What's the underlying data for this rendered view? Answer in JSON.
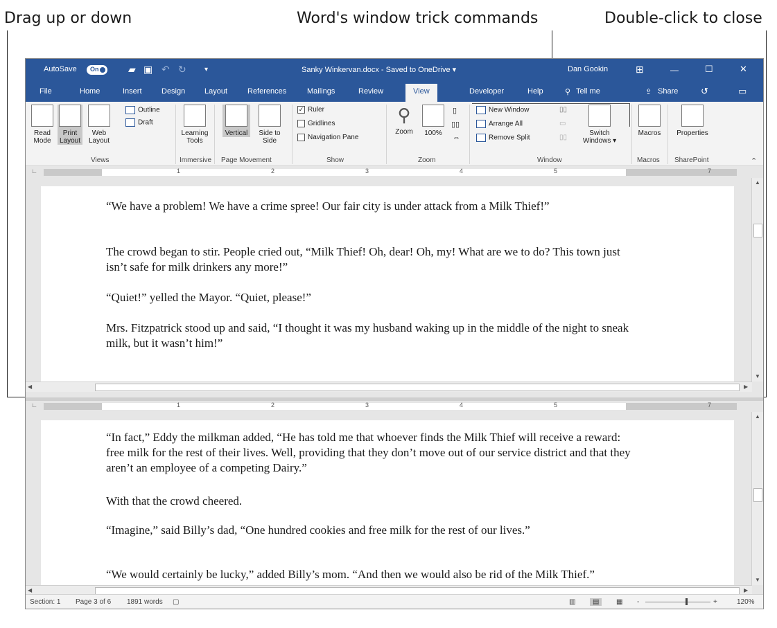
{
  "callouts": {
    "left": "Drag up or down",
    "middle": "Word's window trick commands",
    "right": "Double-click to close"
  },
  "titlebar": {
    "autosave": "AutoSave",
    "toggle": "On",
    "document_title": "Sanky Winkervan.docx - Saved to OneDrive ▾",
    "user": "Dan Gookin",
    "minimize": "—",
    "restore": "☐",
    "close": "✕"
  },
  "tabs": [
    "File",
    "Home",
    "Insert",
    "Design",
    "Layout",
    "References",
    "Mailings",
    "Review",
    "View",
    "Developer",
    "Help"
  ],
  "tell_me": "Tell me",
  "share": "Share",
  "ribbon": {
    "views": {
      "read_mode": "Read Mode",
      "print_layout": "Print Layout",
      "web_layout": "Web Layout",
      "outline": "Outline",
      "draft": "Draft",
      "label": "Views"
    },
    "immersive": {
      "learning_tools": "Learning Tools",
      "label": "Immersive"
    },
    "page_movement": {
      "vertical": "Vertical",
      "side_to_side": "Side to Side",
      "label": "Page Movement"
    },
    "show": {
      "ruler": "Ruler",
      "gridlines": "Gridlines",
      "navigation_pane": "Navigation Pane",
      "label": "Show"
    },
    "zoom": {
      "zoom": "Zoom",
      "percent": "100%",
      "label": "Zoom"
    },
    "window": {
      "new_window": "New Window",
      "arrange_all": "Arrange All",
      "remove_split": "Remove Split",
      "switch_windows": "Switch Windows ▾",
      "label": "Window"
    },
    "macros": {
      "macros": "Macros",
      "label": "Macros"
    },
    "sharepoint": {
      "properties": "Properties",
      "label": "SharePoint"
    }
  },
  "ruler_numbers": [
    "1",
    "2",
    "3",
    "4",
    "5",
    "7"
  ],
  "pane_top": {
    "paragraphs": [
      "“We have a problem! We have a crime spree! Our fair city is under attack from a Milk Thief!”",
      "The crowd began to stir. People cried out, “Milk Thief! Oh, dear! Oh, my! What are we to do? This town just isn’t safe for milk drinkers any more!”",
      "“Quiet!” yelled the Mayor. “Quiet, please!”",
      "Mrs. Fitzpatrick stood up and said, “I thought it was my husband waking up in the middle of the night to sneak milk, but it wasn’t him!”"
    ]
  },
  "pane_bottom": {
    "paragraphs": [
      "“In fact,” Eddy the milkman added, “He has told me that whoever finds the Milk Thief will receive a reward: free milk for the rest of their lives. Well, providing that they don’t move out of our service district and that they aren’t an employee of a competing Dairy.”",
      "With that the crowd cheered.",
      "“Imagine,” said Billy’s dad, “One hundred cookies and free milk for the rest of our lives.”",
      "“We would certainly be lucky,” added Billy’s mom. “And then we would also be rid of the Milk Thief.”"
    ]
  },
  "statusbar": {
    "section": "Section: 1",
    "page": "Page 3 of 6",
    "words": "1891 words",
    "zoom_minus": "-",
    "zoom_plus": "+",
    "zoom_level": "120%"
  }
}
